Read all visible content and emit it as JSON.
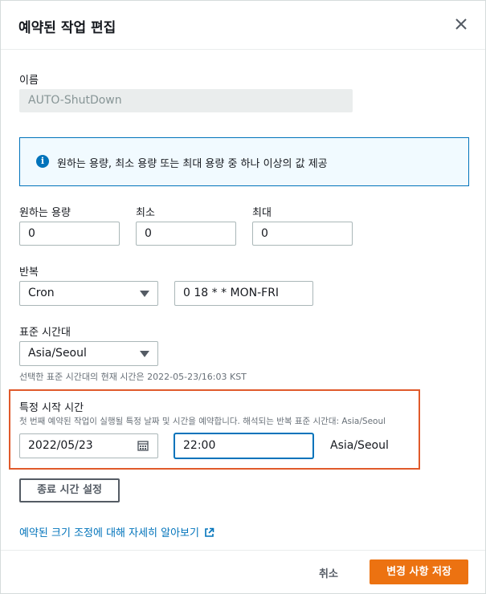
{
  "dialog": {
    "title": "예약된 작업 편집"
  },
  "name": {
    "label": "이름",
    "value": "AUTO-ShutDown"
  },
  "info": {
    "icon": "info-icon",
    "text": "원하는 용량, 최소 용량 또는 최대 용량 중 하나 이상의 값 제공"
  },
  "capacity": {
    "desired_label": "원하는 용량",
    "desired_value": "0",
    "min_label": "최소",
    "min_value": "0",
    "max_label": "최대",
    "max_value": "0"
  },
  "recurrence": {
    "label": "반복",
    "selected": "Cron",
    "expression": "0 18 * * MON-FRI"
  },
  "timezone": {
    "label": "표준 시간대",
    "selected": "Asia/Seoul",
    "hint": "선택한 표준 시간대의 현재 시간은 2022-05-23/16:03 KST"
  },
  "start_time": {
    "label": "특정 시작 시간",
    "hint": "첫 번째 예약된 작업이 실행될 특정 날짜 및 시간을 예약합니다. 해석되는 반복 표준 시간대: Asia/Seoul",
    "date": "2022/05/23",
    "time": "22:00",
    "timezone": "Asia/Seoul",
    "highlight_color": "#e05a2b"
  },
  "end_time_button": "종료 시간 설정",
  "learn_more_link": "예약된 크기 조정에 대해 자세히 알아보기",
  "footer": {
    "cancel": "취소",
    "save": "변경 사항 저장"
  },
  "colors": {
    "primary": "#ec7211",
    "link": "#0073bb",
    "info_border": "#0073bb",
    "info_bg": "#f1faff"
  }
}
